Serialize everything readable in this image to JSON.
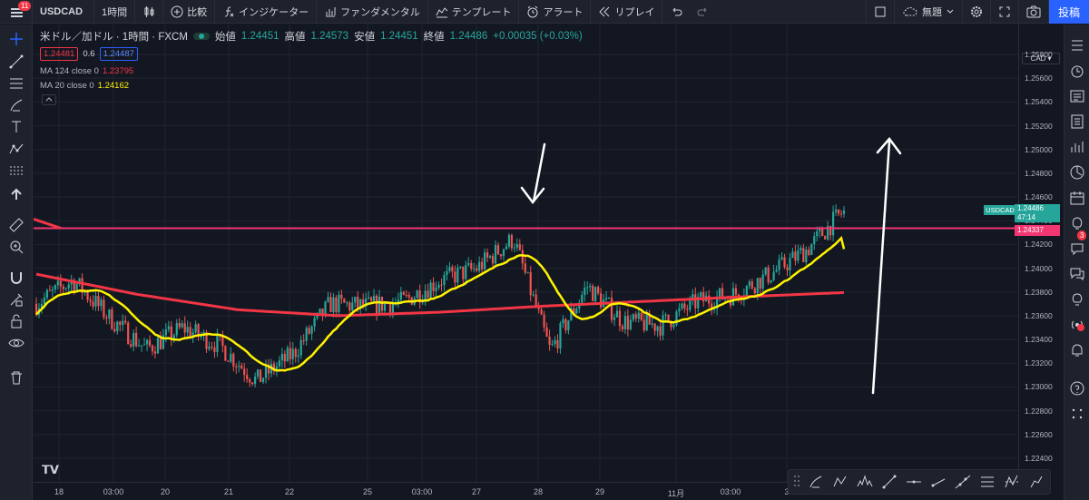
{
  "topbar": {
    "notification_count": "11",
    "symbol": "USDCAD",
    "interval": "1時間",
    "compare": "比較",
    "indicators": "インジケーター",
    "fundamentals": "ファンダメンタル",
    "templates": "テンプレート",
    "alert": "アラート",
    "replay": "リプレイ",
    "layout_name": "無題",
    "post": "投稿"
  },
  "legend": {
    "title": "米ドル／加ドル · 1時間 · FXCM",
    "open_label": "始値",
    "open": "1.24451",
    "high_label": "高値",
    "high": "1.24573",
    "low_label": "安値",
    "low": "1.24451",
    "close_label": "終値",
    "close": "1.24486",
    "change": "+0.00035 (+0.03%)",
    "bid": "1.24481",
    "spread": "0.6",
    "ask": "1.24487",
    "ma1_label": "MA 124 close 0",
    "ma1_value": "1.23795",
    "ma2_label": "MA 20 close 0",
    "ma2_value": "1.24162"
  },
  "price_scale": {
    "currency": "CAD",
    "ticks": [
      "1.25800",
      "1.25600",
      "1.25400",
      "1.25200",
      "1.25000",
      "1.24800",
      "1.24600",
      "1.24400",
      "1.24200",
      "1.24000",
      "1.23800",
      "1.23600",
      "1.23400",
      "1.23200",
      "1.23000",
      "1.22800",
      "1.22600",
      "1.22400"
    ],
    "last_symbol": "USDCAD",
    "last_price": "1.24486",
    "countdown": "47:14",
    "horizontal_line_price": "1.24337"
  },
  "time_scale": {
    "ticks": [
      "18",
      "03:00",
      "20",
      "21",
      "22",
      "25",
      "03:00",
      "27",
      "28",
      "29",
      "11月",
      "03:00",
      "3"
    ]
  },
  "colors": {
    "background": "#131722",
    "up": "#26a69a",
    "down": "#ef5350",
    "ma_long": "#f23645",
    "ma_short": "#fff200",
    "hline": "#f23672",
    "annotation_arrows": "#ffffff",
    "accent": "#2962ff"
  },
  "chart_data": {
    "type": "candlestick",
    "symbol": "USDCAD",
    "interval": "1時間",
    "ylim": [
      1.223,
      1.259
    ],
    "horizontal_line": 1.24337,
    "close_path": [
      {
        "x": "18",
        "y": 1.237
      },
      {
        "x": "18 03:00",
        "y": 1.239
      },
      {
        "x": "19",
        "y": 1.2358
      },
      {
        "x": "20",
        "y": 1.2332
      },
      {
        "x": "20 12:00",
        "y": 1.235
      },
      {
        "x": "21",
        "y": 1.2335
      },
      {
        "x": "21 12:00",
        "y": 1.2305
      },
      {
        "x": "22",
        "y": 1.2328
      },
      {
        "x": "22 12:00",
        "y": 1.237
      },
      {
        "x": "25",
        "y": 1.2368
      },
      {
        "x": "25 03:00",
        "y": 1.2372
      },
      {
        "x": "25 12:00",
        "y": 1.239
      },
      {
        "x": "27",
        "y": 1.24
      },
      {
        "x": "27 12:00",
        "y": 1.2425
      },
      {
        "x": "28",
        "y": 1.233
      },
      {
        "x": "28 12:00",
        "y": 1.2385
      },
      {
        "x": "29",
        "y": 1.2355
      },
      {
        "x": "29 12:00",
        "y": 1.2352
      },
      {
        "x": "11月",
        "y": 1.2372
      },
      {
        "x": "11月 03:00",
        "y": 1.2378
      },
      {
        "x": "11月 12:00",
        "y": 1.2395
      },
      {
        "x": "3",
        "y": 1.2416
      },
      {
        "x": "3 latest",
        "y": 1.24486
      }
    ],
    "ma_124": {
      "name": "MA 124 close 0",
      "last": 1.23795
    },
    "ma_20": {
      "name": "MA 20 close 0",
      "last": 1.24162
    }
  }
}
